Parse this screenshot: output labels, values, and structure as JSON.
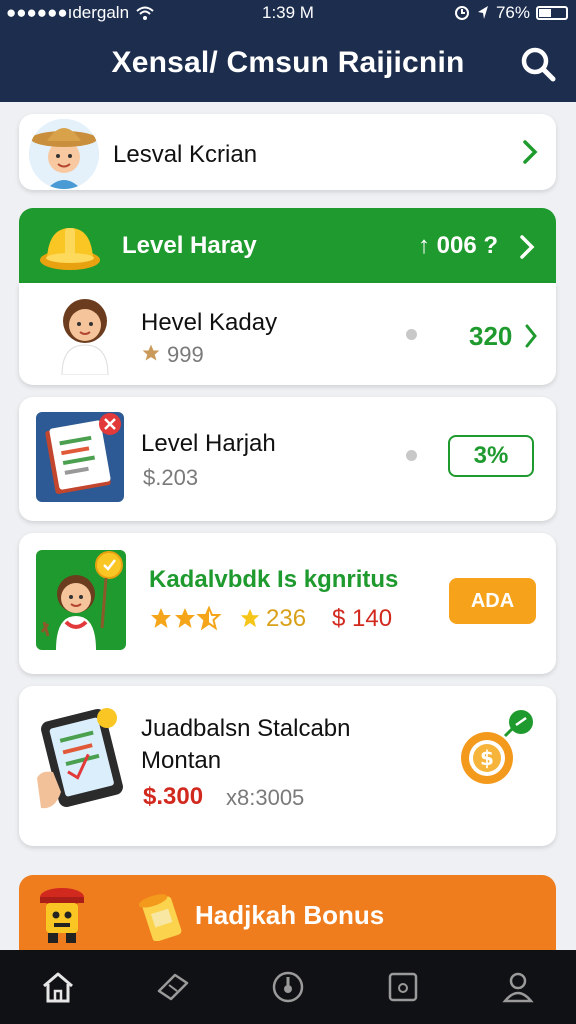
{
  "status_bar": {
    "carrier": "●●●●●●ıdergaln",
    "time": "1:39 M",
    "battery": "76%"
  },
  "header": {
    "title": "Xensal/ Cmsun Raijicnin"
  },
  "profile": {
    "name": "Lesval Kcrian"
  },
  "level_banner": {
    "label": "Level Haray",
    "value": "↑ 006 ?"
  },
  "rows": [
    {
      "title": "Hevel Kaday",
      "sub": "999",
      "value": "320"
    },
    {
      "title": "Level Harjah",
      "sub": "$.203",
      "button": "3%"
    },
    {
      "title": "Kadalvbdk Is kgnritus",
      "rating_value": "236",
      "price": "$ 140",
      "button": "ADA"
    },
    {
      "title": "Juadbalsn Stalcabn",
      "title2": "Montan",
      "price": "$.300",
      "sub": "x8:3005"
    }
  ],
  "bonus": {
    "label": "Hadjkah Bonus"
  },
  "colors": {
    "navy": "#1c2d4e",
    "green": "#1f9a2e",
    "orange": "#ef7d1e",
    "amber": "#f6a21a",
    "red": "#d2291f"
  },
  "nav": [
    "home-icon",
    "ticket-icon",
    "clock-icon",
    "square-icon",
    "profile-icon"
  ]
}
